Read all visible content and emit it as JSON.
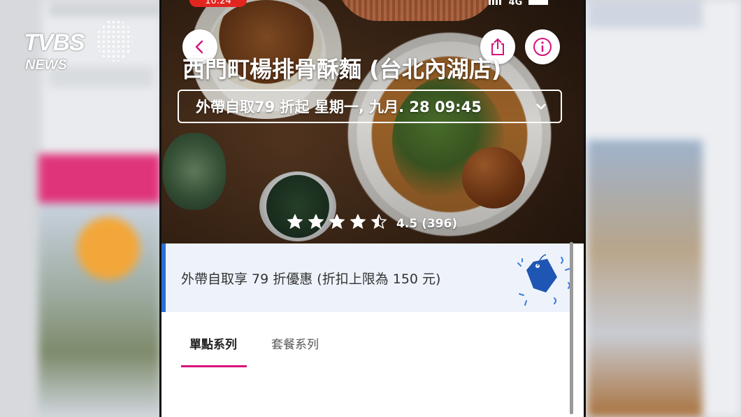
{
  "overlay": {
    "logo_main": "TVBS",
    "logo_sub": "NEWS"
  },
  "status_bar": {
    "time": "10:24",
    "network": "4G"
  },
  "store": {
    "name": "西門町楊排骨酥麵 (台北內湖店)",
    "pickup_option": "外帶自取79 折起 星期一, 九月. 28 09:45",
    "rating_value": "4.5",
    "rating_count": "(396)",
    "rating_stars": 4.5
  },
  "promo": {
    "text": "外帶自取享 79 折優惠 (折扣上限為 150 元)"
  },
  "tabs": [
    {
      "label": "單點系列"
    },
    {
      "label": "套餐系列"
    }
  ],
  "icons": {
    "back": "chevron-left-icon",
    "share": "share-icon",
    "info": "info-icon",
    "dropdown": "chevron-down-icon",
    "promo": "price-tag-icon"
  },
  "colors": {
    "brand_pink": "#d7137a",
    "promo_bg": "#eef3fb",
    "promo_accent": "#2b6fd6",
    "status_badge": "#e2261f"
  }
}
